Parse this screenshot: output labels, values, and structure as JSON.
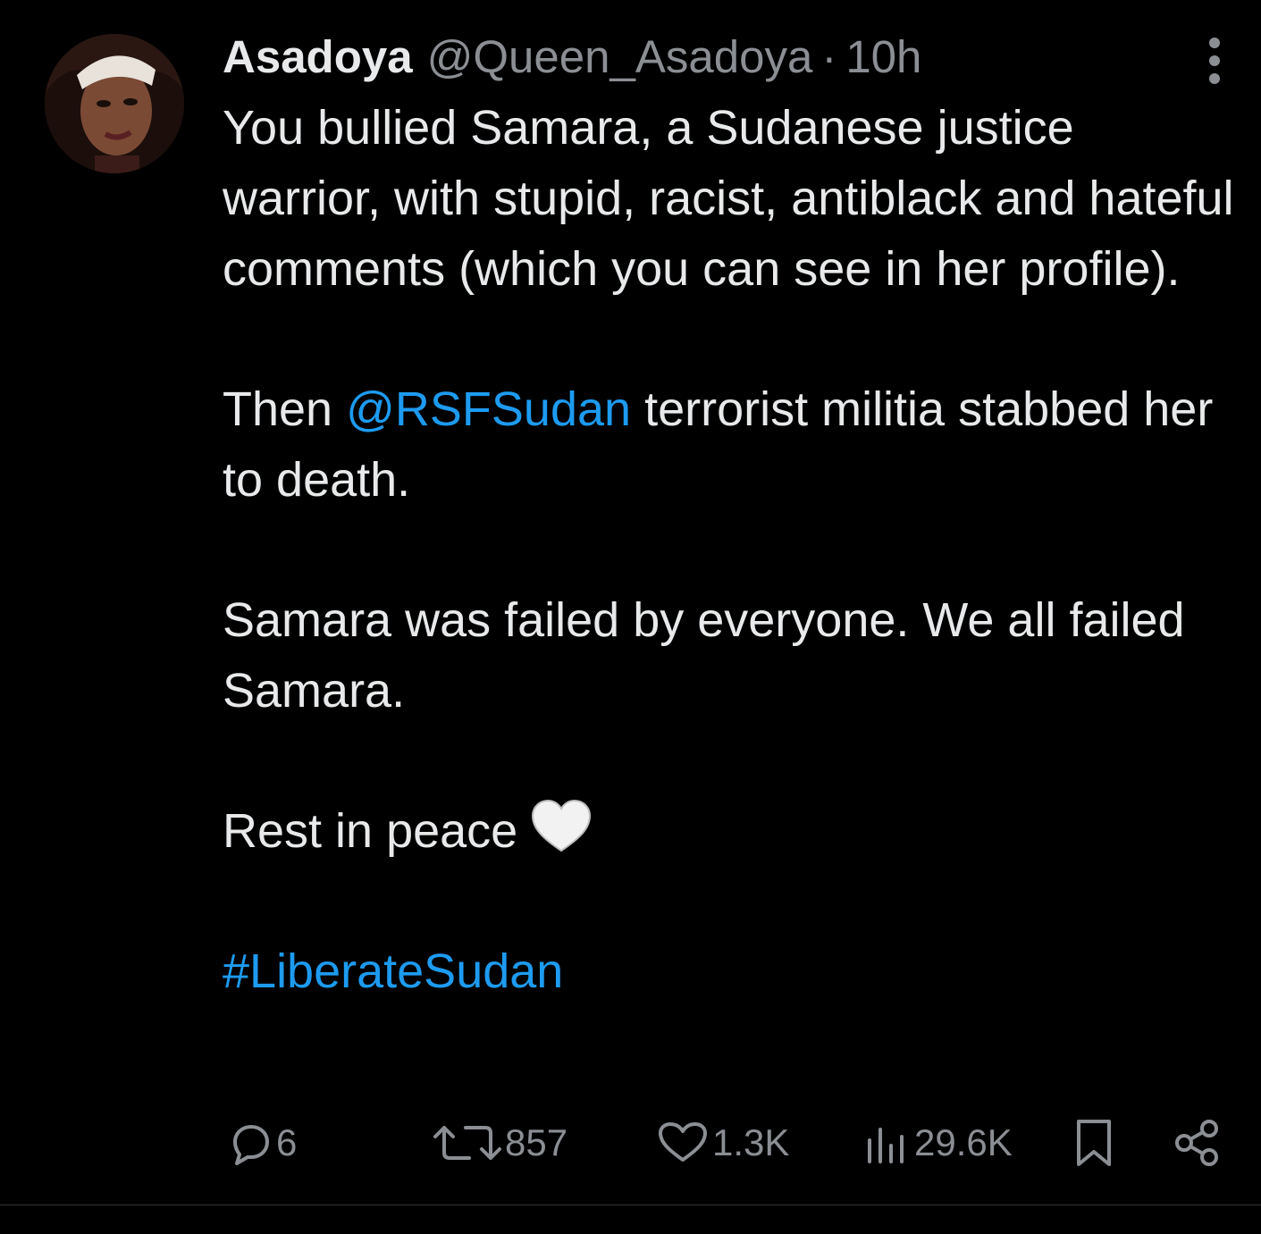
{
  "tweet": {
    "author_name": "Asadoya",
    "author_handle": "@Queen_Asadoya",
    "separator": "·",
    "time": "10h",
    "body": {
      "p1": "You bullied Samara, a Sudanese justice warrior, with stupid, racist, antiblack and hateful comments (which you can see in her profile).",
      "p2_before": "Then ",
      "p2_mention": "@RSFSudan",
      "p2_after": " terrorist militia stabbed her to death.",
      "p3": "Samara was failed by everyone. We all failed Samara.",
      "p4": "Rest in peace",
      "p5_hashtag": "#LiberateSudan"
    },
    "stats": {
      "replies": "6",
      "reposts": "857",
      "likes": "1.3K",
      "views": "29.6K"
    }
  },
  "icons": {
    "more": "more-vertical-icon",
    "reply": "reply-icon",
    "repost": "repost-icon",
    "like": "heart-icon",
    "views": "views-chart-icon",
    "bookmark": "bookmark-icon",
    "share": "share-icon",
    "emoji": "white-heart-emoji"
  },
  "colors": {
    "background": "#000000",
    "text": "#e7e9ea",
    "secondary": "#8b8f94",
    "link": "#1d9bf0",
    "divider": "#2f3336"
  }
}
